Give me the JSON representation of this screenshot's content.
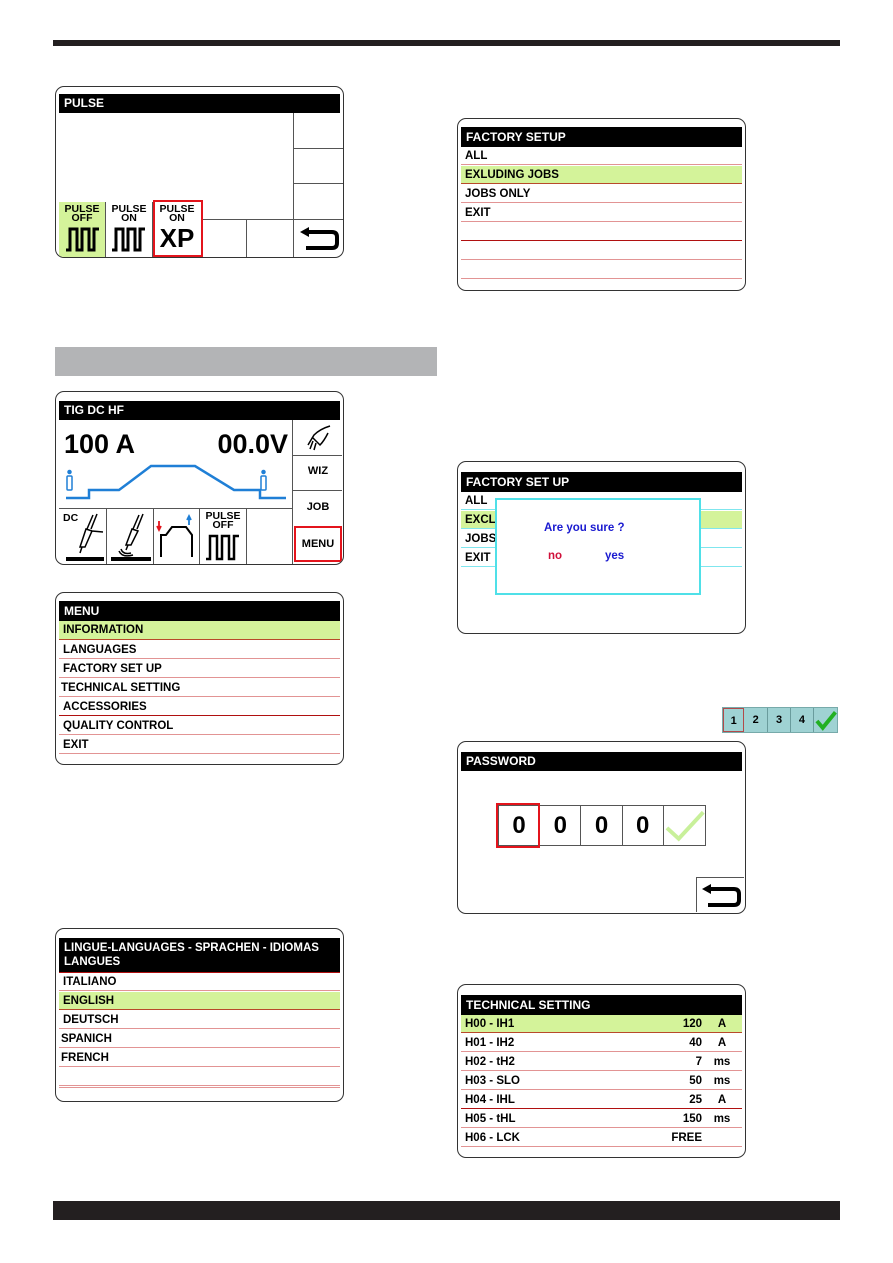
{
  "page": {
    "top_rule_color": "#231f20",
    "section_band_color": "#b3b4b6"
  },
  "colors": {
    "highlight": "#d4f39a",
    "selection_box": "#e3141c",
    "curve": "#1f7fd6",
    "dialog_border": "#4fe0e8",
    "dialog_text": "#1a1ad0",
    "no_text": "#d0103a"
  },
  "pulse_screen": {
    "title": "PULSE",
    "options": [
      {
        "line1": "PULSE",
        "line2": "OFF",
        "icon": "pulse-wave-icon",
        "selected_bg": true
      },
      {
        "line1": "PULSE",
        "line2": "ON",
        "icon": "pulse-wave-icon"
      },
      {
        "line1": "PULSE",
        "line2": "ON",
        "icon_text": "XP",
        "highlighted": true
      }
    ],
    "back_icon": "return-arrow-icon"
  },
  "factory_setup": {
    "title": "FACTORY SETUP",
    "items": [
      "ALL",
      "EXLUDING JOBS",
      "JOBS ONLY",
      "EXIT",
      "",
      "",
      ""
    ],
    "selected_index": 1
  },
  "tig_screen": {
    "title": "TIG DC HF",
    "current": "100 A",
    "voltage": "00.0V",
    "side_buttons": [
      {
        "icon": "torch-hand-icon"
      },
      {
        "label": "WIZ"
      },
      {
        "label": "JOB"
      },
      {
        "label": "MENU",
        "highlighted": true
      }
    ],
    "bottom": [
      {
        "label": "DC",
        "icon": "torch-icon"
      },
      {
        "icon": "torch-arc-icon"
      },
      {
        "icon": "trigger-cycle-icon"
      },
      {
        "line1": "PULSE",
        "line2": "OFF",
        "icon": "pulse-wave-icon"
      }
    ]
  },
  "menu": {
    "title": "MENU",
    "items": [
      "INFORMATION",
      "LANGUAGES",
      "FACTORY SET UP",
      "TECHNICAL SETTING",
      "ACCESSORIES",
      "QUALITY CONTROL",
      "EXIT"
    ],
    "selected_index": 0
  },
  "confirm_screen": {
    "title": "FACTORY SET UP",
    "items": [
      "ALL",
      "EXCL",
      "JOBS",
      "EXIT"
    ],
    "dialog": {
      "question": "Are you sure ?",
      "no": "no",
      "yes": "yes"
    }
  },
  "digit_strip": {
    "digits": [
      "1",
      "2",
      "3",
      "4"
    ],
    "confirm_icon": "check-icon"
  },
  "password": {
    "title": "PASSWORD",
    "digits": [
      "0",
      "0",
      "0",
      "0"
    ],
    "active_index": 0,
    "confirm_icon": "check-icon",
    "back_icon": "return-arrow-icon"
  },
  "languages": {
    "title_line1": "LINGUE-LANGUAGES - SPRACHEN - IDIOMAS",
    "title_line2": "LANGUES",
    "items": [
      "ITALIANO",
      "ENGLISH",
      "DEUTSCH",
      "SPANICH",
      "FRENCH",
      "",
      ""
    ],
    "selected_index": 1
  },
  "technical_setting": {
    "title": "TECHNICAL SETTING",
    "rows": [
      {
        "name": "H00 - IH1",
        "value": "120",
        "unit": "A"
      },
      {
        "name": "H01 - IH2",
        "value": "40",
        "unit": "A"
      },
      {
        "name": "H02 - tH2",
        "value": "7",
        "unit": "ms"
      },
      {
        "name": "H03 - SLO",
        "value": "50",
        "unit": "ms"
      },
      {
        "name": "H04 - IHL",
        "value": "25",
        "unit": "A"
      },
      {
        "name": "H05 - tHL",
        "value": "150",
        "unit": "ms"
      },
      {
        "name": "H06 - LCK",
        "value": "FREE",
        "unit": ""
      }
    ],
    "selected_index": 0
  }
}
